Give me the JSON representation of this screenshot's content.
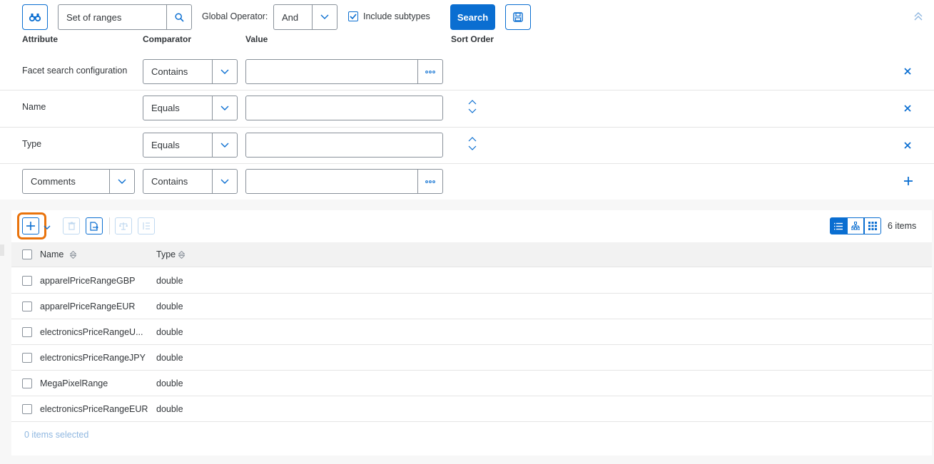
{
  "search": {
    "type_value": "Set of ranges",
    "global_operator_label": "Global Operator:",
    "global_operator_value": "And",
    "include_subtypes_label": "Include subtypes",
    "search_label": "Search"
  },
  "headers": {
    "attribute": "Attribute",
    "comparator": "Comparator",
    "value": "Value",
    "sort_order": "Sort Order"
  },
  "criteria": [
    {
      "attribute": "Facet search configuration",
      "comparator": "Contains",
      "value": ""
    },
    {
      "attribute": "Name",
      "comparator": "Equals",
      "value": ""
    },
    {
      "attribute": "Type",
      "comparator": "Equals",
      "value": ""
    },
    {
      "attribute": "Comments",
      "comparator": "Contains",
      "value": ""
    }
  ],
  "toolbar": {
    "items_count": "6 items"
  },
  "table": {
    "columns": [
      "Name",
      "Type"
    ],
    "rows": [
      {
        "name": "apparelPriceRangeGBP",
        "type": "double"
      },
      {
        "name": "apparelPriceRangeEUR",
        "type": "double"
      },
      {
        "name": "electronicsPriceRangeU...",
        "type": "double"
      },
      {
        "name": "electronicsPriceRangeJPY",
        "type": "double"
      },
      {
        "name": "MegaPixelRange",
        "type": "double"
      },
      {
        "name": "electronicsPriceRangeEUR",
        "type": "double"
      }
    ],
    "selection_status": "0 items selected"
  },
  "colors": {
    "accent": "#0a6ed1",
    "highlight": "#e9730c",
    "text": "#32363a"
  }
}
